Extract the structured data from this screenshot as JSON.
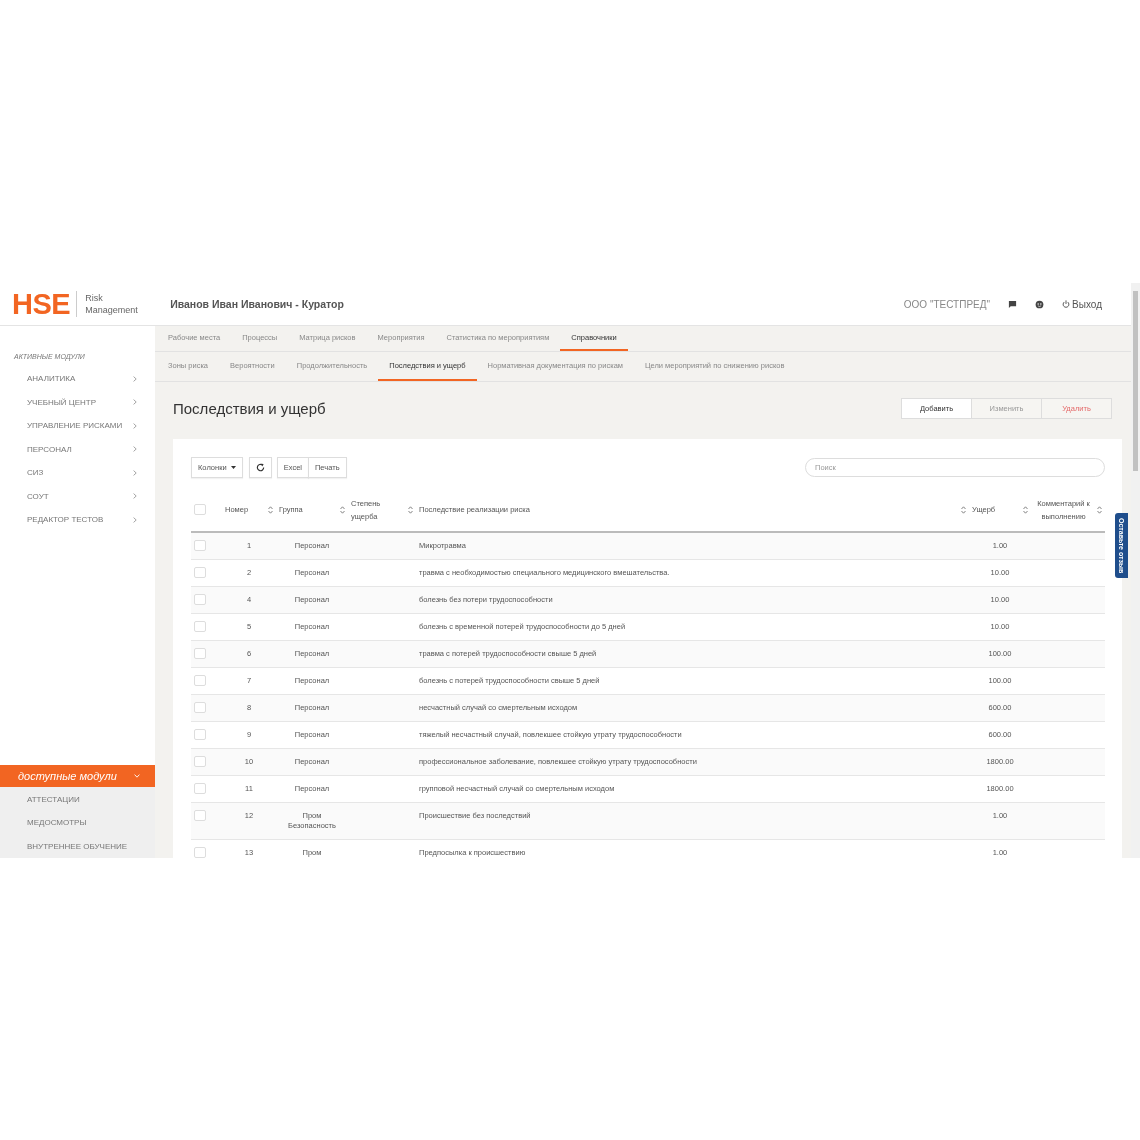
{
  "header": {
    "logo_mark": "HSE",
    "logo_lines": [
      "Risk",
      "Management"
    ],
    "user": "Иванов Иван Иванович - Куратор",
    "company": "ООО \"ТЕСТПРЕД\"",
    "logout": "Выход"
  },
  "sidebar": {
    "section_title": "АКТИВНЫЕ МОДУЛИ",
    "items": [
      {
        "label": "АНАЛИТИКА"
      },
      {
        "label": "УЧЕБНЫЙ ЦЕНТР"
      },
      {
        "label": "УПРАВЛЕНИЕ РИСКАМИ"
      },
      {
        "label": "ПЕРСОНАЛ"
      },
      {
        "label": "СИЗ"
      },
      {
        "label": "СОУТ"
      },
      {
        "label": "РЕДАКТОР ТЕСТОВ"
      }
    ],
    "available": {
      "label": "доступные модули",
      "expanded": true,
      "items": [
        "АТТЕСТАЦИИ",
        "МЕДОСМОТРЫ",
        "ВНУТРЕННЕЕ ОБУЧЕНИЕ"
      ]
    }
  },
  "top_tabs": [
    {
      "label": "Рабочие места",
      "selected": false
    },
    {
      "label": "Процессы",
      "selected": false
    },
    {
      "label": "Матрица рисков",
      "selected": false
    },
    {
      "label": "Мероприятия",
      "selected": false
    },
    {
      "label": "Статистика по мероприятиям",
      "selected": false
    },
    {
      "label": "Справочники",
      "selected": true
    }
  ],
  "sub_tabs": [
    {
      "label": "Зоны риска",
      "selected": false
    },
    {
      "label": "Вероятности",
      "selected": false
    },
    {
      "label": "Продолжительность",
      "selected": false
    },
    {
      "label": "Последствия и ущерб",
      "selected": true
    },
    {
      "label": "Нормативная документация по рискам",
      "selected": false
    },
    {
      "label": "Цели мероприятий по снижению рисков",
      "selected": false
    }
  ],
  "page_title": "Последствия и ущерб",
  "actions": [
    {
      "label": "Добавить",
      "kind": "primary"
    },
    {
      "label": "Изменить",
      "kind": "default"
    },
    {
      "label": "Удалить",
      "kind": "danger"
    }
  ],
  "toolbar": {
    "columns_button": "Колонки",
    "export_buttons": [
      "Excel",
      "Печать"
    ],
    "search": {
      "placeholder": "Поиск"
    }
  },
  "table": {
    "select_all": {
      "checked": false
    },
    "columns": [
      {
        "label": "Номер"
      },
      {
        "label": "Группа"
      },
      {
        "label": "Степень ущерба"
      },
      {
        "label": "Последствие реализации риска"
      },
      {
        "label": "Ущерб"
      },
      {
        "label": "Комментарий к выполнению"
      }
    ],
    "rows": [
      {
        "checked": false,
        "cells": [
          "1",
          "Персонал",
          "",
          "Микротравма",
          "1.00",
          ""
        ]
      },
      {
        "checked": false,
        "cells": [
          "2",
          "Персонал",
          "",
          "травма с необходимостью специального медицинского вмешательства.",
          "10.00",
          ""
        ]
      },
      {
        "checked": false,
        "cells": [
          "4",
          "Персонал",
          "",
          "болезнь без потери трудоспособности",
          "10.00",
          ""
        ]
      },
      {
        "checked": false,
        "cells": [
          "5",
          "Персонал",
          "",
          "болезнь с временной потерей трудоспособности до 5 дней",
          "10.00",
          ""
        ]
      },
      {
        "checked": false,
        "cells": [
          "6",
          "Персонал",
          "",
          "травма с потерей трудоспособности свыше 5 дней",
          "100.00",
          ""
        ]
      },
      {
        "checked": false,
        "cells": [
          "7",
          "Персонал",
          "",
          "болезнь с потерей трудоспособности свыше 5 дней",
          "100.00",
          ""
        ]
      },
      {
        "checked": false,
        "cells": [
          "8",
          "Персонал",
          "",
          "несчастный случай со смертельным исходом",
          "600.00",
          ""
        ]
      },
      {
        "checked": false,
        "cells": [
          "9",
          "Персонал",
          "",
          "тяжелый несчастный случай, повлекшее стойкую утрату трудоспособности",
          "600.00",
          ""
        ]
      },
      {
        "checked": false,
        "cells": [
          "10",
          "Персонал",
          "",
          "профессиональное заболевание, повлекшее стойкую утрату трудоспособности",
          "1800.00",
          ""
        ]
      },
      {
        "checked": false,
        "cells": [
          "11",
          "Персонал",
          "",
          "групповой несчастный случай со смертельным исходом",
          "1800.00",
          ""
        ]
      },
      {
        "checked": false,
        "cells": [
          "12",
          "Пром Безопасность",
          "",
          "Происшествие без последствий",
          "1.00",
          ""
        ]
      },
      {
        "checked": false,
        "cells": [
          "13",
          "Пром",
          "",
          "Предпосылка к происшествию",
          "1.00",
          ""
        ]
      }
    ]
  },
  "feedback_tab": "Оставьте отзыв"
}
